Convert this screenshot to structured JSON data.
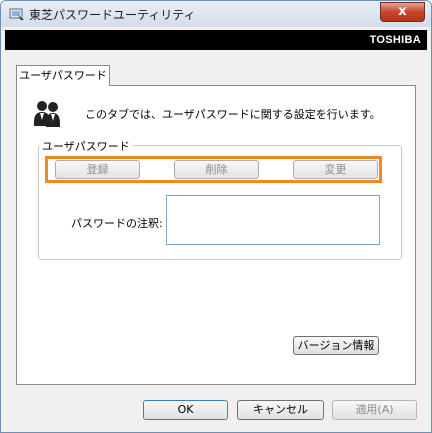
{
  "window": {
    "title": "東芝パスワードユーティリティ",
    "close_label": "x",
    "brand": "TOSHIBA"
  },
  "tabs": [
    {
      "label": "ユーザパスワード",
      "selected": true
    }
  ],
  "panel": {
    "description": "このタブでは、ユーザパスワードに関する設定を行います。",
    "group_title": "ユーザパスワード",
    "buttons": {
      "register": "登録",
      "delete": "削除",
      "change": "変更"
    },
    "note_label": "パスワードの注釈:",
    "note_value": "",
    "version_button": "バージョン情報"
  },
  "footer": {
    "ok": "OK",
    "cancel": "キャンセル",
    "apply": "適用(A)"
  },
  "colors": {
    "highlight": "#f08a1c",
    "brand_bar": "#000000"
  }
}
